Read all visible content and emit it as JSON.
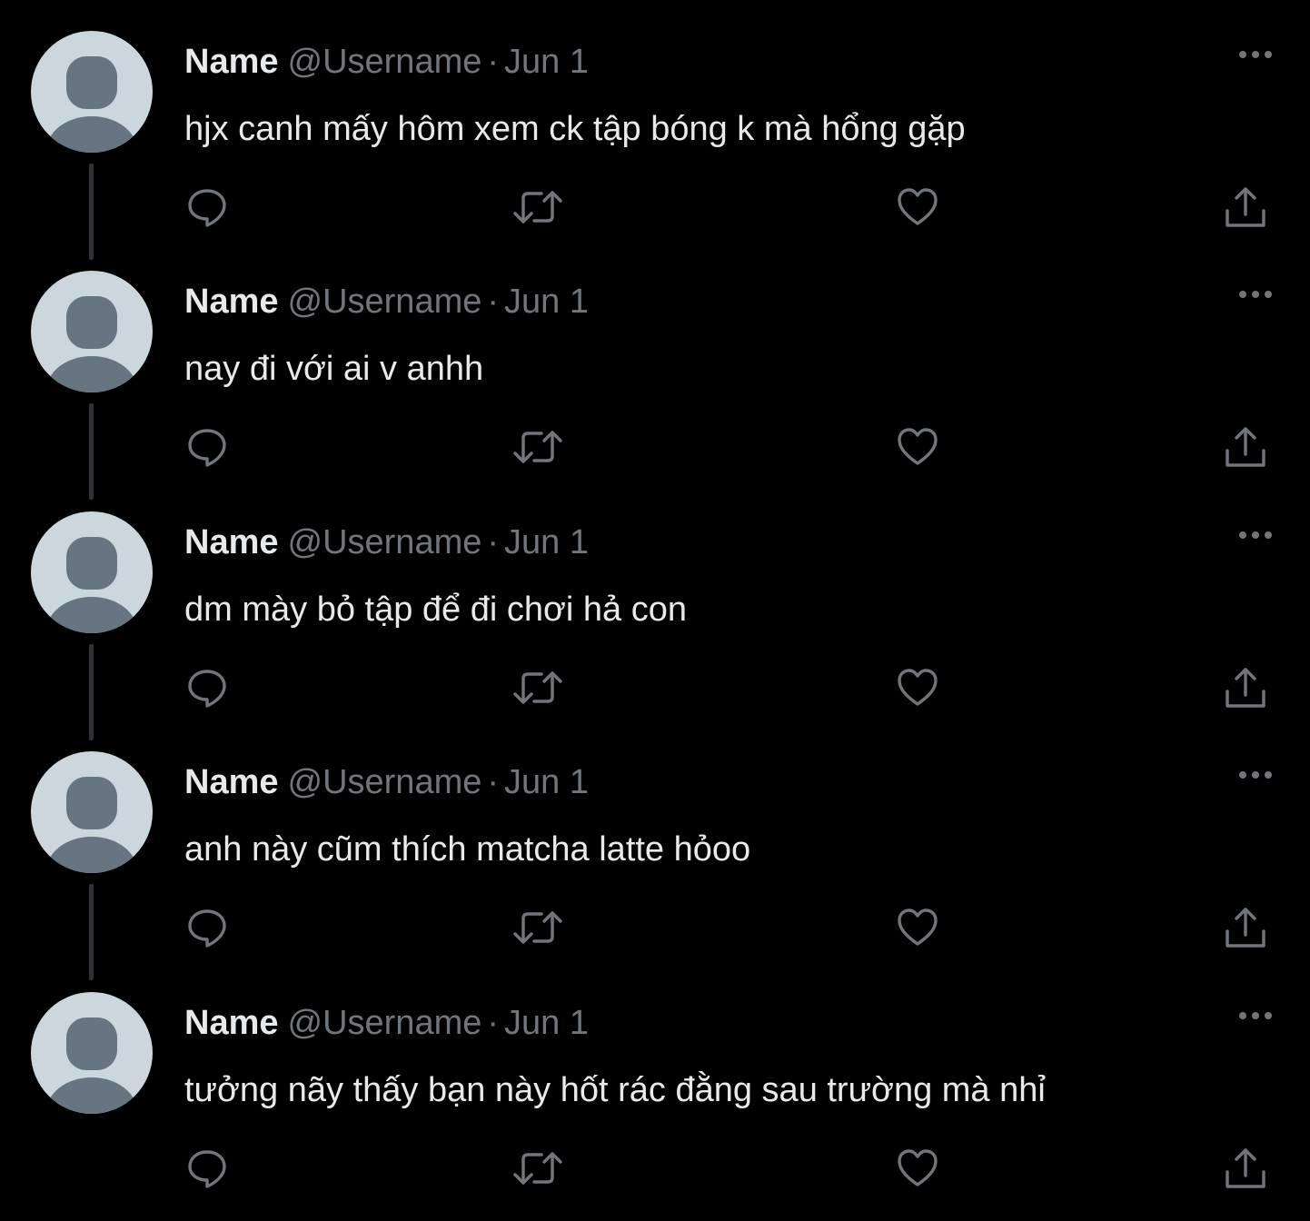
{
  "colors": {
    "background": "#000000",
    "text_primary": "#e7e9ea",
    "text_secondary": "#71767b",
    "avatar_bg": "#ccd6dd",
    "avatar_figure": "#66757f",
    "thread_line": "#2f3336"
  },
  "icons": {
    "reply": "reply-icon",
    "retweet": "retweet-icon",
    "like": "like-icon",
    "share": "share-icon",
    "more": "more-icon",
    "avatar": "default-avatar-icon"
  },
  "tweets": [
    {
      "name": "Name",
      "handle": "@Username",
      "separator": "·",
      "date": "Jun 1",
      "text": "hjx canh mấy hôm xem ck tập bóng k mà hổng gặp"
    },
    {
      "name": "Name",
      "handle": "@Username",
      "separator": "·",
      "date": "Jun 1",
      "text": "nay đi với ai v anhh"
    },
    {
      "name": "Name",
      "handle": "@Username",
      "separator": "·",
      "date": "Jun 1",
      "text": "dm mày bỏ tập để đi chơi hả con"
    },
    {
      "name": "Name",
      "handle": "@Username",
      "separator": "·",
      "date": "Jun 1",
      "text": "anh này cũm thích matcha latte hỏoo"
    },
    {
      "name": "Name",
      "handle": "@Username",
      "separator": "·",
      "date": "Jun 1",
      "text": "tưởng nãy thấy bạn này hốt rác đằng sau trường mà nhỉ"
    }
  ]
}
